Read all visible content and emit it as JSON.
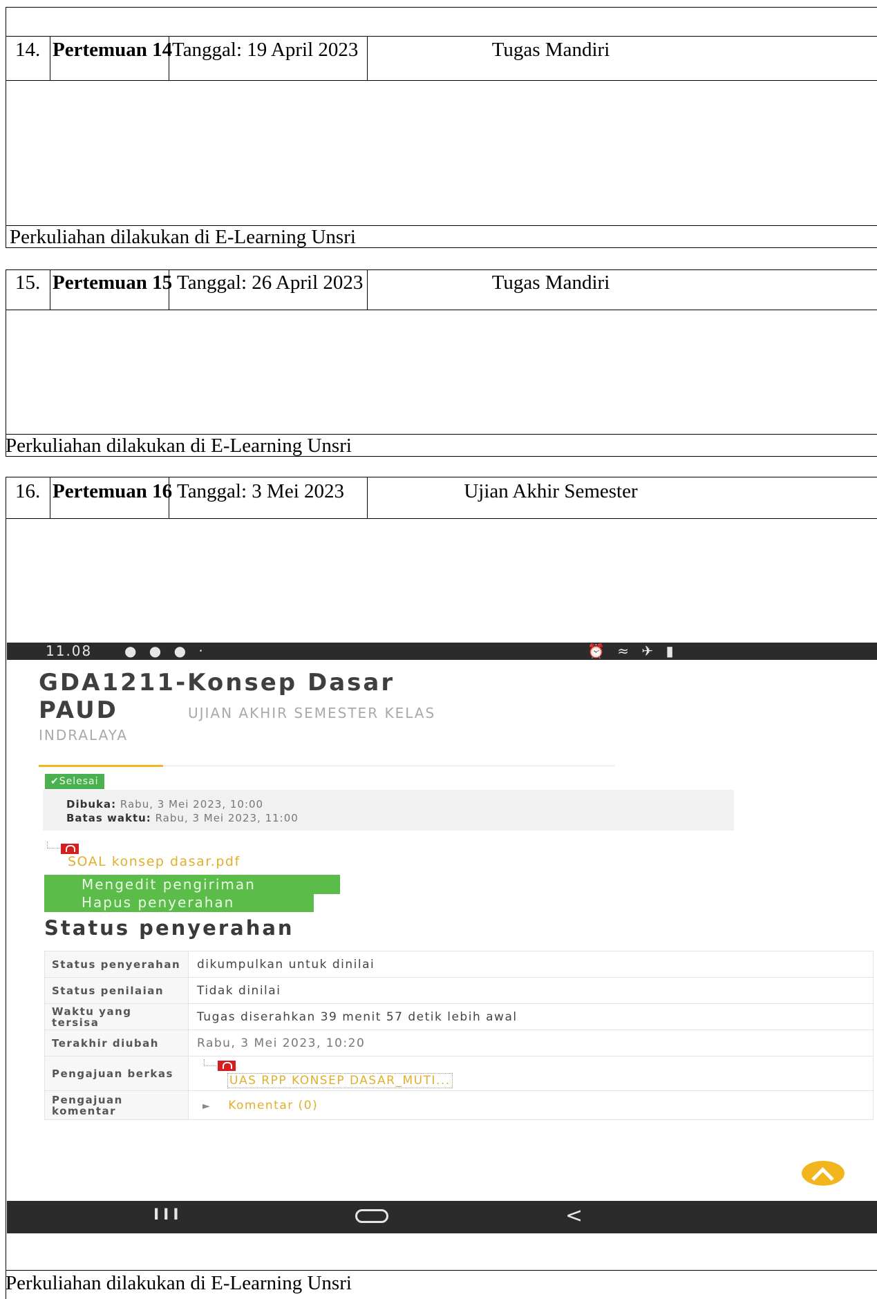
{
  "rows": [
    {
      "no": "14.",
      "title": "Pertemuan 14",
      "date": "Tanggal: 19 April 2023",
      "activity": "Tugas Mandiri",
      "note": "Perkuliahan dilakukan di E-Learning Unsri"
    },
    {
      "no": "15.",
      "title": "Pertemuan 15",
      "date": "Tanggal: 26 April 2023",
      "activity": "Tugas Mandiri",
      "note": "Perkuliahan dilakukan di E-Learning Unsri"
    },
    {
      "no": "16.",
      "title": "Pertemuan 16",
      "date": "Tanggal: 3 Mei 2023",
      "activity": "Ujian Akhir Semester",
      "note": "Perkuliahan dilakukan di E-Learning Unsri"
    }
  ],
  "screenshot": {
    "status_time": "11.08",
    "course_line1": "GDA1211-Konsep Dasar",
    "course_line2": "PAUD",
    "assignment_part1": "UJIAN AKHIR SEMESTER KELAS",
    "assignment_part2": "INDRALAYA",
    "badge": "Selesai",
    "opened_label": "Dibuka:",
    "opened_value": "Rabu, 3 Mei 2023, 10:00",
    "due_label": "Batas waktu:",
    "due_value": "Rabu, 3 Mei 2023, 11:00",
    "attachment": "SOAL konsep dasar.pdf",
    "edit_button": "Mengedit pengiriman",
    "delete_button": "Hapus penyerahan",
    "status_heading": "Status penyerahan",
    "status_rows": [
      {
        "label": "Status penyerahan",
        "value": "dikumpulkan untuk dinilai"
      },
      {
        "label": "Status penilaian",
        "value": "Tidak dinilai"
      },
      {
        "label": "Waktu yang tersisa",
        "value": "Tugas diserahkan 39 menit 57 detik lebih awal"
      },
      {
        "label": "Terakhir diubah",
        "value": "Rabu, 3 Mei 2023, 10:20"
      },
      {
        "label": "Pengajuan berkas",
        "value": "UAS RPP KONSEP DASAR_MUTI..."
      },
      {
        "label": "Pengajuan komentar",
        "value": "Komentar (0)"
      }
    ],
    "nav_recent": "III",
    "nav_back": "<",
    "accent_green": "#5cbc4a",
    "accent_yellow": "#f2b51e"
  }
}
